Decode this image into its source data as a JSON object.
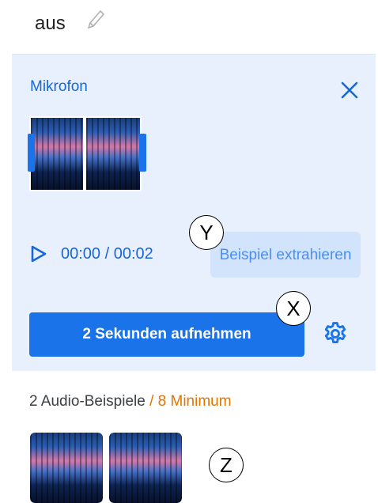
{
  "header": {
    "class_name": "aus"
  },
  "panel": {
    "title": "Mikrofon",
    "time_display": "00:00 / 00:02",
    "extract_label": "Beispiel extrahieren",
    "record_label": "2 Sekunden aufnehmen"
  },
  "samples": {
    "count_text": "2 Audio-Beispiele",
    "minimum_text": " / 8 Minimum"
  },
  "annotations": {
    "x": "X",
    "y": "Y",
    "z": "Z"
  },
  "colors": {
    "accent": "#1a73e8",
    "panel_bg": "#e8f0fe",
    "warning": "#e37400"
  },
  "icons": [
    "pencil-icon",
    "close-icon",
    "play-icon",
    "settings-icon"
  ]
}
